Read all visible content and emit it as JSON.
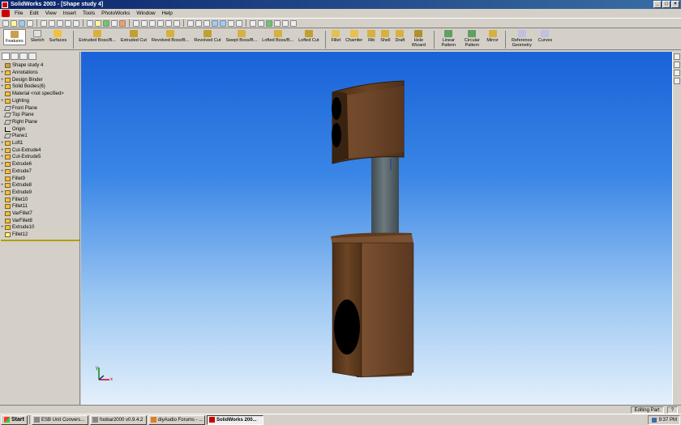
{
  "window": {
    "title": "SolidWorks 2003 - [Shape study 4]"
  },
  "menu": [
    "File",
    "Edit",
    "View",
    "Insert",
    "Tools",
    "PhotoWorks",
    "Window",
    "Help"
  ],
  "command_manager": [
    {
      "label": "Features",
      "pressed": true
    },
    {
      "label": "Sketch"
    },
    {
      "label": "Surfaces"
    },
    {
      "label": "Extruded Boss/B..."
    },
    {
      "label": "Extruded Cut"
    },
    {
      "label": "Revolved Boss/B..."
    },
    {
      "label": "Revolved Cut"
    },
    {
      "label": "Swept Boss/B..."
    },
    {
      "label": "Lofted Boss/B..."
    },
    {
      "label": "Lofted Cut"
    },
    {
      "label": "Fillet"
    },
    {
      "label": "Chamfer"
    },
    {
      "label": "Rib"
    },
    {
      "label": "Shell"
    },
    {
      "label": "Draft"
    },
    {
      "label": "Hole Wizard"
    },
    {
      "label": "Linear Pattern"
    },
    {
      "label": "Circular Pattern"
    },
    {
      "label": "Mirror"
    },
    {
      "label": "Reference Geometry"
    },
    {
      "label": "Curves"
    }
  ],
  "tree": [
    {
      "label": "Shape study 4",
      "icon": "part"
    },
    {
      "label": "Annotations",
      "icon": "feat",
      "plus": true
    },
    {
      "label": "Design Binder",
      "icon": "feat",
      "plus": true
    },
    {
      "label": "Solid Bodies(6)",
      "icon": "feat",
      "plus": true
    },
    {
      "label": "Material <not specified>",
      "icon": "feat"
    },
    {
      "label": "Lighting",
      "icon": "feat",
      "plus": true
    },
    {
      "label": "Front Plane",
      "icon": "plane"
    },
    {
      "label": "Top Plane",
      "icon": "plane"
    },
    {
      "label": "Right Plane",
      "icon": "plane"
    },
    {
      "label": "Origin",
      "icon": "origin"
    },
    {
      "label": "Plane1",
      "icon": "plane"
    },
    {
      "label": "Loft1",
      "icon": "feat",
      "plus": true
    },
    {
      "label": "Cut-Extrude4",
      "icon": "feat",
      "plus": true
    },
    {
      "label": "Cut-Extrude5",
      "icon": "feat",
      "plus": true
    },
    {
      "label": "Extrude6",
      "icon": "feat",
      "plus": true
    },
    {
      "label": "Extrude7",
      "icon": "feat",
      "plus": true
    },
    {
      "label": "Fillet9",
      "icon": "feat"
    },
    {
      "label": "Extrude8",
      "icon": "feat",
      "plus": true
    },
    {
      "label": "Extrude9",
      "icon": "feat",
      "plus": true
    },
    {
      "label": "Fillet10",
      "icon": "feat"
    },
    {
      "label": "Fillet11",
      "icon": "feat"
    },
    {
      "label": "VarFillet7",
      "icon": "feat"
    },
    {
      "label": "VarFillet8",
      "icon": "feat"
    },
    {
      "label": "Extrude10",
      "icon": "feat",
      "plus": true
    },
    {
      "label": "Fillet12",
      "icon": "sel"
    }
  ],
  "statusbar": {
    "mode": "Editing Part",
    "help": "?"
  },
  "taskbar": {
    "start": "Start",
    "tasks": [
      {
        "label": "ESB Unit Convers..."
      },
      {
        "label": "foobar2000 v0.9.4.2"
      },
      {
        "label": "diyAudio Forums - ..."
      },
      {
        "label": "SolidWorks 200...",
        "active": true
      }
    ],
    "clock": "9:37 PM"
  },
  "colors": {
    "title_start": "#0a246a",
    "title_end": "#3a6ea5",
    "viewport_top": "#1a62d8",
    "viewport_bottom": "#e4f0fb",
    "wood": "#6b4424",
    "pipe": "#5a6870"
  },
  "triad_labels": {
    "x": "x",
    "y": "y"
  }
}
